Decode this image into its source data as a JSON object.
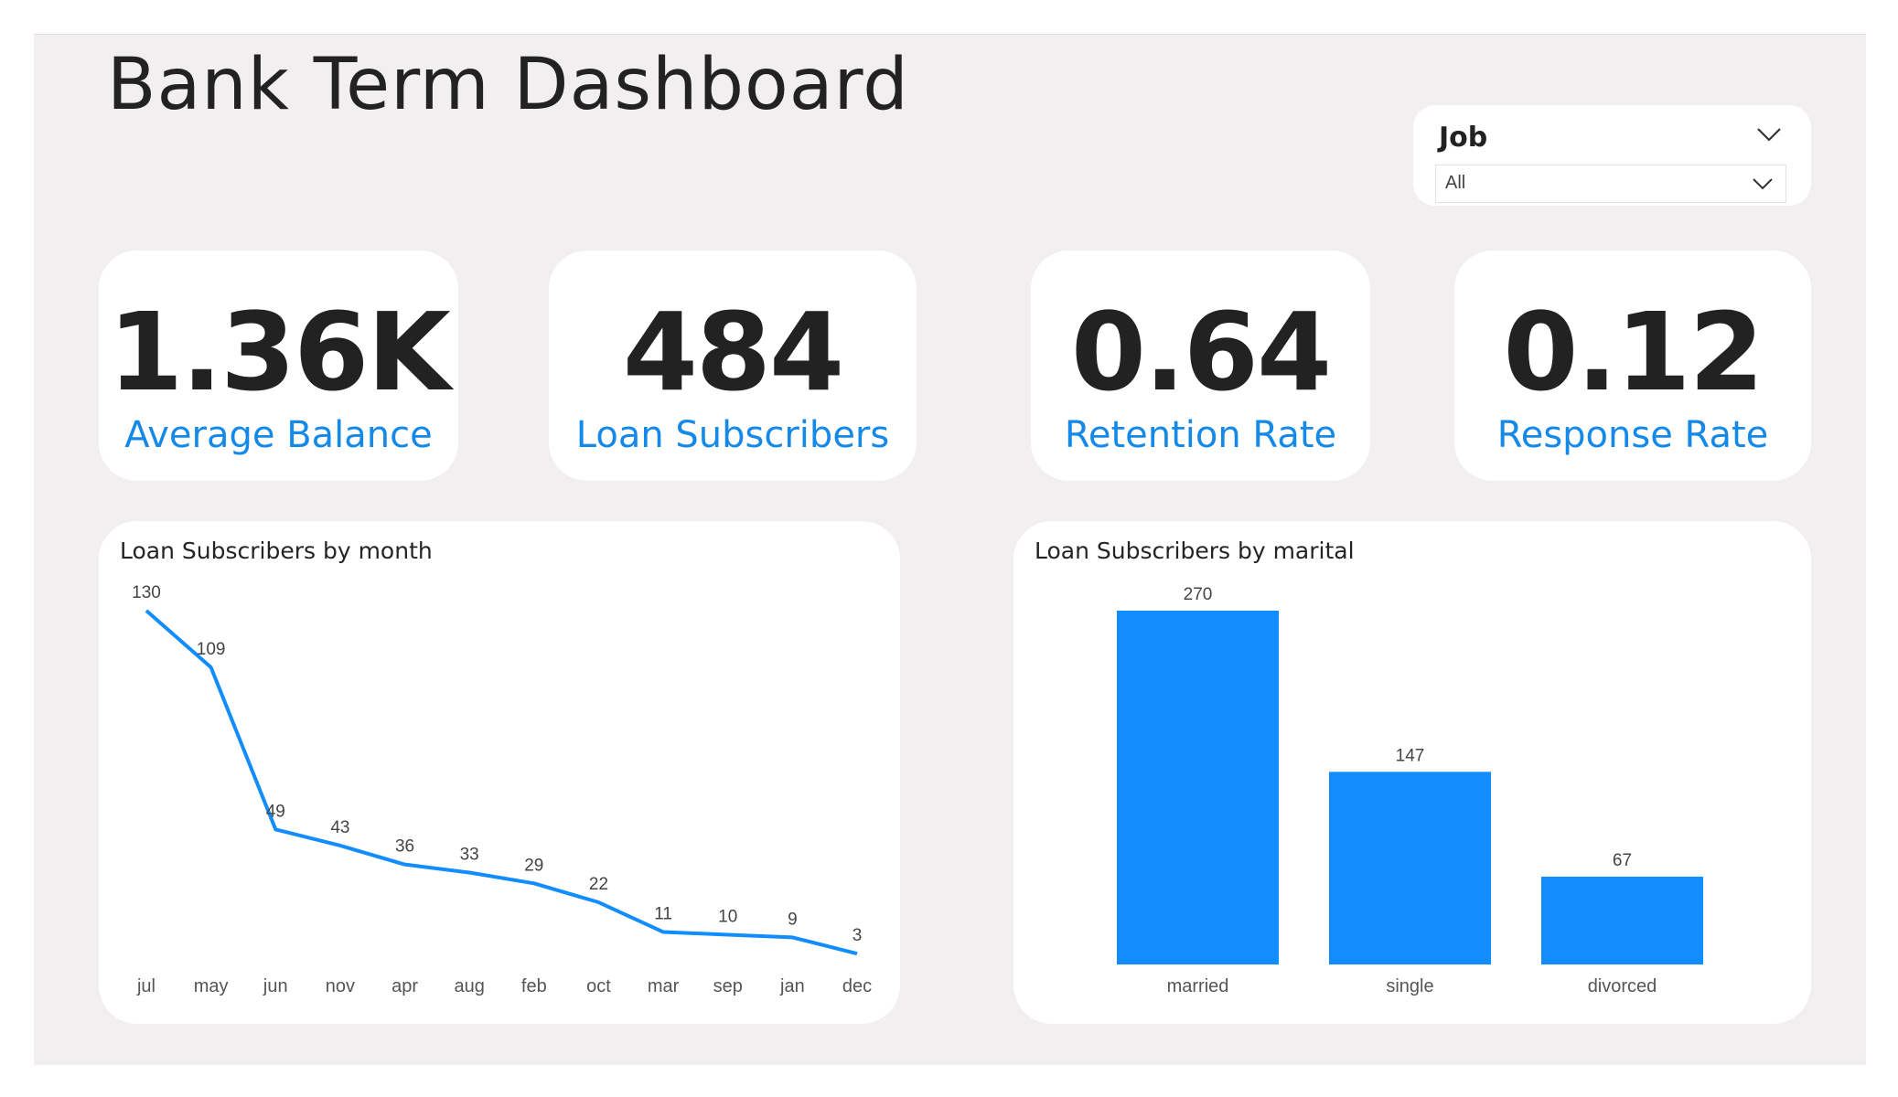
{
  "header": {
    "title": "Bank Term Dashboard"
  },
  "slicer": {
    "label": "Job",
    "value": "All"
  },
  "kpis": [
    {
      "value": "1.36K",
      "label": "Average Balance"
    },
    {
      "value": "484",
      "label": "Loan Subscribers"
    },
    {
      "value": "0.64",
      "label": "Retention Rate"
    },
    {
      "value": "0.12",
      "label": "Response Rate"
    }
  ],
  "colors": {
    "accent": "#1589e8",
    "bar": "#118dff",
    "canvas": "#f1eff0"
  },
  "chart_data": [
    {
      "type": "line",
      "title": "Loan Subscribers by month",
      "categories": [
        "jul",
        "may",
        "jun",
        "nov",
        "apr",
        "aug",
        "feb",
        "oct",
        "mar",
        "sep",
        "jan",
        "dec"
      ],
      "values": [
        130,
        109,
        49,
        43,
        36,
        33,
        29,
        22,
        11,
        10,
        9,
        3
      ],
      "ylim": [
        0,
        130
      ],
      "grid": false
    },
    {
      "type": "bar",
      "title": "Loan Subscribers by marital",
      "categories": [
        "married",
        "single",
        "divorced"
      ],
      "values": [
        270,
        147,
        67
      ],
      "ylim": [
        0,
        270
      ],
      "grid": false
    }
  ]
}
